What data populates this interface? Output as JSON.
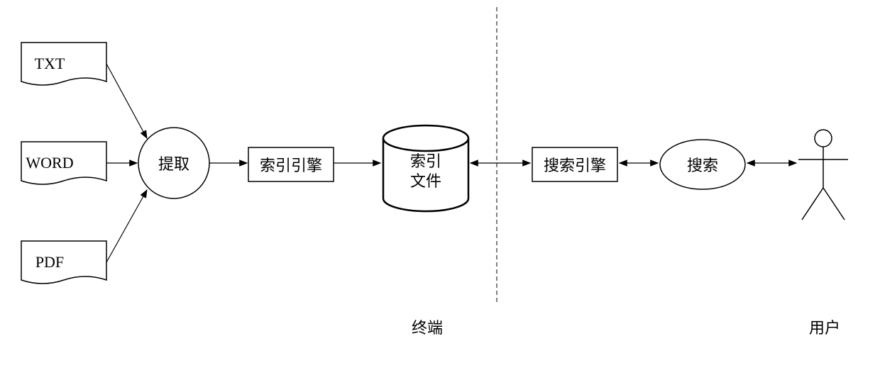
{
  "inputs": {
    "txt": "TXT",
    "word": "WORD",
    "pdf": "PDF"
  },
  "extract": "提取",
  "indexEngine": "索引引擎",
  "indexFile": {
    "line1": "索引",
    "line2": "文件"
  },
  "searchEngine": "搜索引擎",
  "search": "搜索",
  "terminalLabel": "终端",
  "userLabel": "用户"
}
